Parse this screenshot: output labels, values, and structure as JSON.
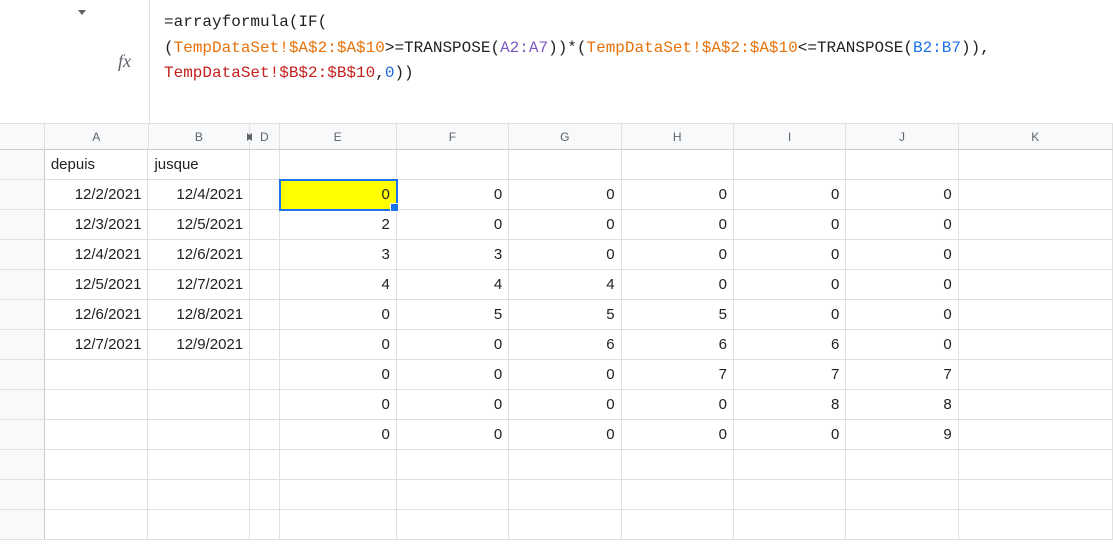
{
  "fx_label": "fx",
  "formula": {
    "prefix": "=",
    "fn1": "arrayformula",
    "fn2": "IF",
    "fn3a": "TRANSPOSE",
    "fn3b": "TRANSPOSE",
    "ref_temp_a": "TempDataSet!$A$2:$A$10",
    "ref_a2a7": "A2:A7",
    "ref_b2b7": "B2:B7",
    "ref_temp_b": "TempDataSet!$B$2:$B$10",
    "zero": "0"
  },
  "columns": {
    "A": "A",
    "B": "B",
    "D": "D",
    "E": "E",
    "F": "F",
    "G": "G",
    "H": "H",
    "I": "I",
    "J": "J",
    "K": "K"
  },
  "headers": {
    "A": "depuis",
    "B": "jusque"
  },
  "data_rows": [
    {
      "A": "12/2/2021",
      "B": "12/4/2021",
      "E": "0",
      "F": "0",
      "G": "0",
      "H": "0",
      "I": "0",
      "J": "0"
    },
    {
      "A": "12/3/2021",
      "B": "12/5/2021",
      "E": "2",
      "F": "0",
      "G": "0",
      "H": "0",
      "I": "0",
      "J": "0"
    },
    {
      "A": "12/4/2021",
      "B": "12/6/2021",
      "E": "3",
      "F": "3",
      "G": "0",
      "H": "0",
      "I": "0",
      "J": "0"
    },
    {
      "A": "12/5/2021",
      "B": "12/7/2021",
      "E": "4",
      "F": "4",
      "G": "4",
      "H": "0",
      "I": "0",
      "J": "0"
    },
    {
      "A": "12/6/2021",
      "B": "12/8/2021",
      "E": "0",
      "F": "5",
      "G": "5",
      "H": "5",
      "I": "0",
      "J": "0"
    },
    {
      "A": "12/7/2021",
      "B": "12/9/2021",
      "E": "0",
      "F": "0",
      "G": "6",
      "H": "6",
      "I": "6",
      "J": "0"
    },
    {
      "A": "",
      "B": "",
      "E": "0",
      "F": "0",
      "G": "0",
      "H": "7",
      "I": "7",
      "J": "7"
    },
    {
      "A": "",
      "B": "",
      "E": "0",
      "F": "0",
      "G": "0",
      "H": "0",
      "I": "8",
      "J": "8"
    },
    {
      "A": "",
      "B": "",
      "E": "0",
      "F": "0",
      "G": "0",
      "H": "0",
      "I": "0",
      "J": "9"
    }
  ]
}
